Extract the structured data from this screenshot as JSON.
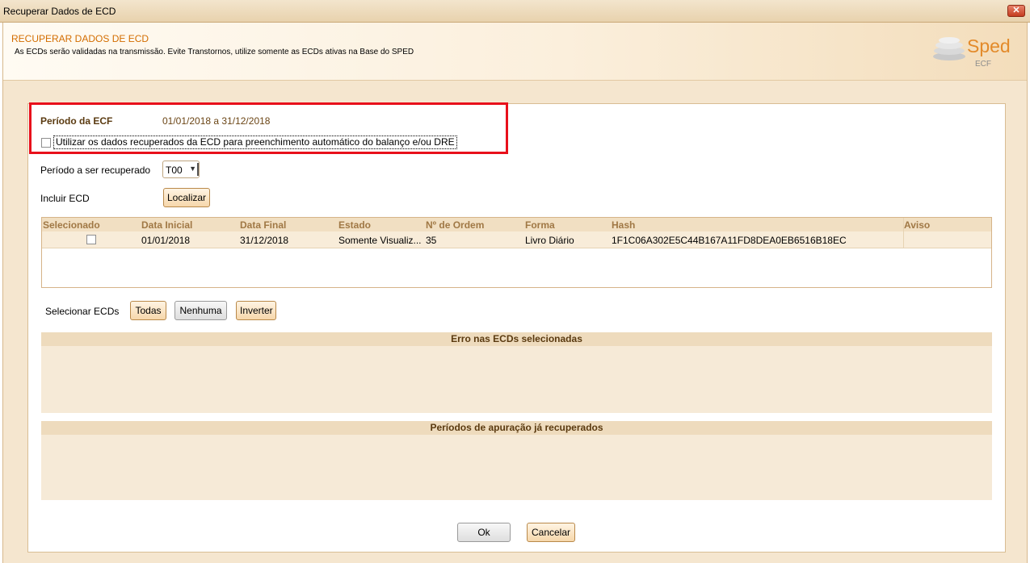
{
  "window": {
    "title": "Recuperar Dados de ECD",
    "close_glyph": "✕"
  },
  "header": {
    "title": "RECUPERAR DADOS DE ECD",
    "subtitle": "As ECDs serão validadas na transmissão. Evite Transtornos, utilize somente as ECDs ativas na Base do SPED",
    "logo_text": "Sped",
    "logo_sub": "ECF"
  },
  "periodo": {
    "label": "Período da ECF",
    "value": "01/01/2018 a 31/12/2018"
  },
  "auto_fill": {
    "checked": false,
    "label": "Utilizar os dados recuperados da ECD para preenchimento automático do balanço e/ou DRE"
  },
  "periodo_recuperado": {
    "label": "Período a ser recuperado",
    "selected": "T00"
  },
  "incluir": {
    "label": "Incluir ECD",
    "button": "Localizar"
  },
  "table": {
    "columns": [
      "Selecionado",
      "Data Inicial",
      "Data Final",
      "Estado",
      "Nº de Ordem",
      "Forma",
      "Hash",
      "Aviso"
    ],
    "rows": [
      {
        "selecionado": false,
        "data_inicial": "01/01/2018",
        "data_final": "31/12/2018",
        "estado": "Somente Visualiz...",
        "ordem": "35",
        "forma": "Livro Diário",
        "hash": "1F1C06A302E5C44B167A11FD8DEA0EB6516B18EC",
        "aviso": ""
      }
    ]
  },
  "selecionar": {
    "label": "Selecionar ECDs",
    "todas": "Todas",
    "nenhuma": "Nenhuma",
    "inverter": "Inverter"
  },
  "erro_section": {
    "title": "Erro nas ECDs selecionadas"
  },
  "periodos_section": {
    "title": "Períodos de apuração já recuperados"
  },
  "footer": {
    "ok": "Ok",
    "cancelar": "Cancelar"
  },
  "colors": {
    "accent": "#d36d00",
    "highlight_box": "#e8101b",
    "panel_bg": "#f5e6cf"
  }
}
